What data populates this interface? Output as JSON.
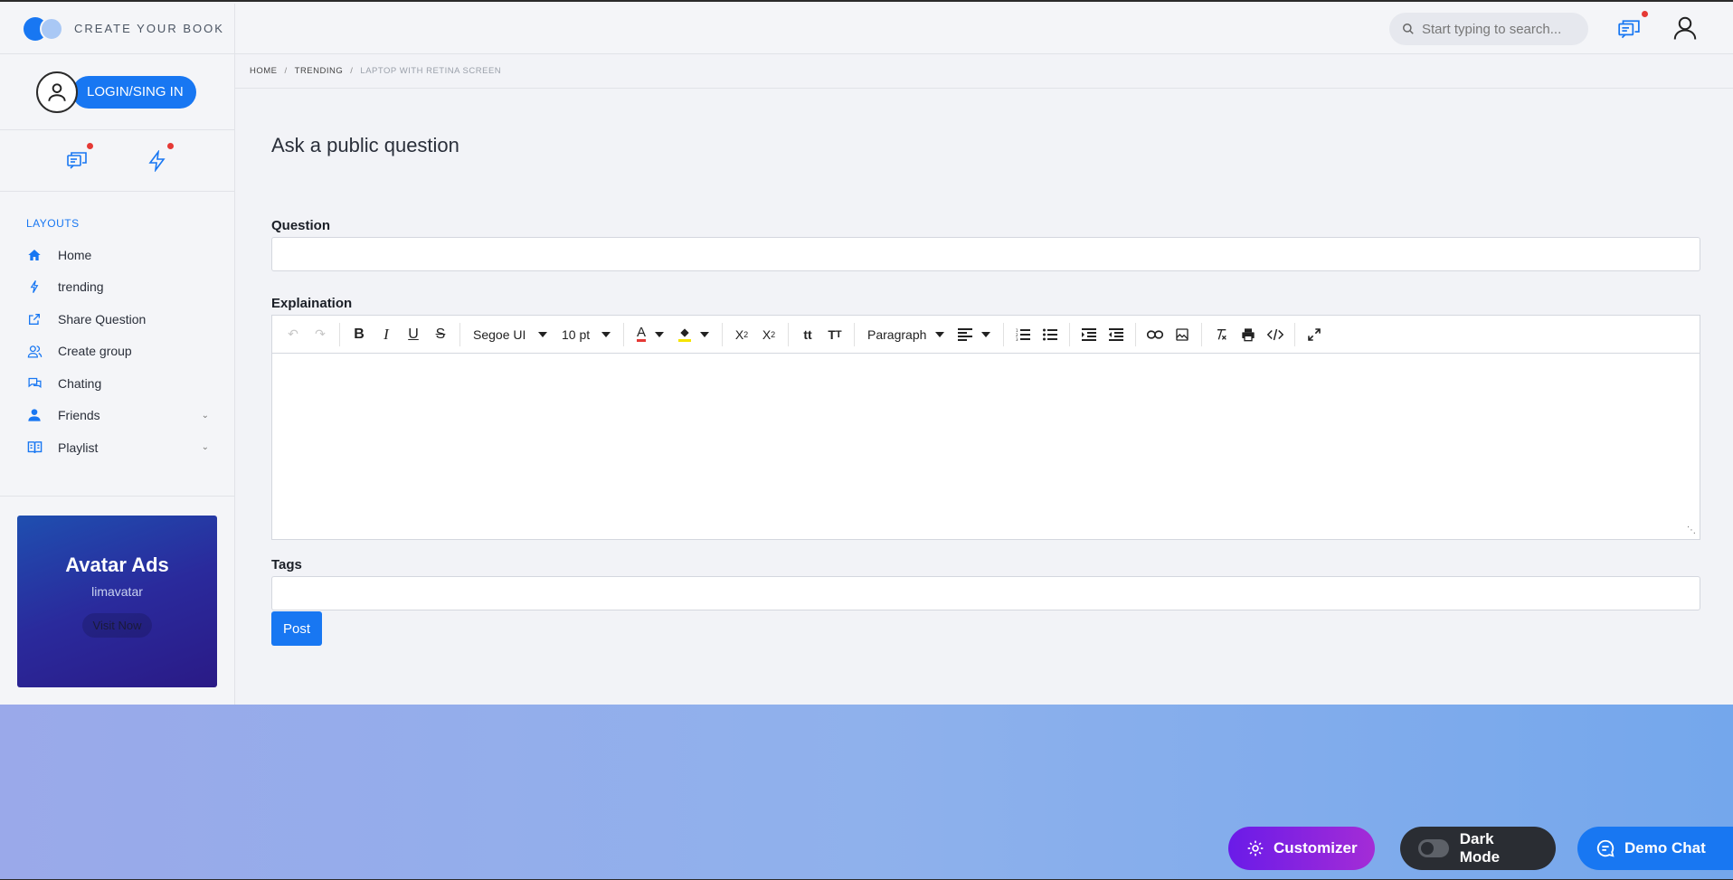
{
  "brand": {
    "name": "CREATE YOUR BOOK"
  },
  "sidebar": {
    "login_label": "LOGIN/SING IN",
    "nav_title": "LAYOUTS",
    "items": [
      {
        "label": "Home",
        "icon": "home-icon"
      },
      {
        "label": "trending",
        "icon": "lightning-icon"
      },
      {
        "label": "Share Question",
        "icon": "share-icon"
      },
      {
        "label": "Create group",
        "icon": "group-icon"
      },
      {
        "label": "Chating",
        "icon": "chat-icon"
      },
      {
        "label": "Friends",
        "icon": "user-icon",
        "expandable": true
      },
      {
        "label": "Playlist",
        "icon": "book-icon",
        "expandable": true
      }
    ],
    "ad": {
      "title": "Avatar Ads",
      "subtitle": "limavatar",
      "button": "Visit Now"
    }
  },
  "header": {
    "search_placeholder": "Start typing to search..."
  },
  "breadcrumb": [
    "HOME",
    "TRENDING",
    "LAPTOP WITH RETINA SCREEN"
  ],
  "form": {
    "title": "Ask a public question",
    "question_label": "Question",
    "question_value": "",
    "explanation_label": "Explaination",
    "tags_label": "Tags",
    "tags_value": "",
    "post_label": "Post"
  },
  "editor": {
    "font_family": "Segoe UI",
    "font_size": "10 pt",
    "block_format": "Paragraph"
  },
  "floating": {
    "customizer": "Customizer",
    "dark_mode": "Dark Mode",
    "demo_chat": "Demo Chat"
  },
  "colors": {
    "accent": "#1877f2",
    "notification": "#e53935",
    "customizer_gradient": [
      "#6a1be8",
      "#a42cd6"
    ],
    "dark_button": "#2a2d33"
  }
}
